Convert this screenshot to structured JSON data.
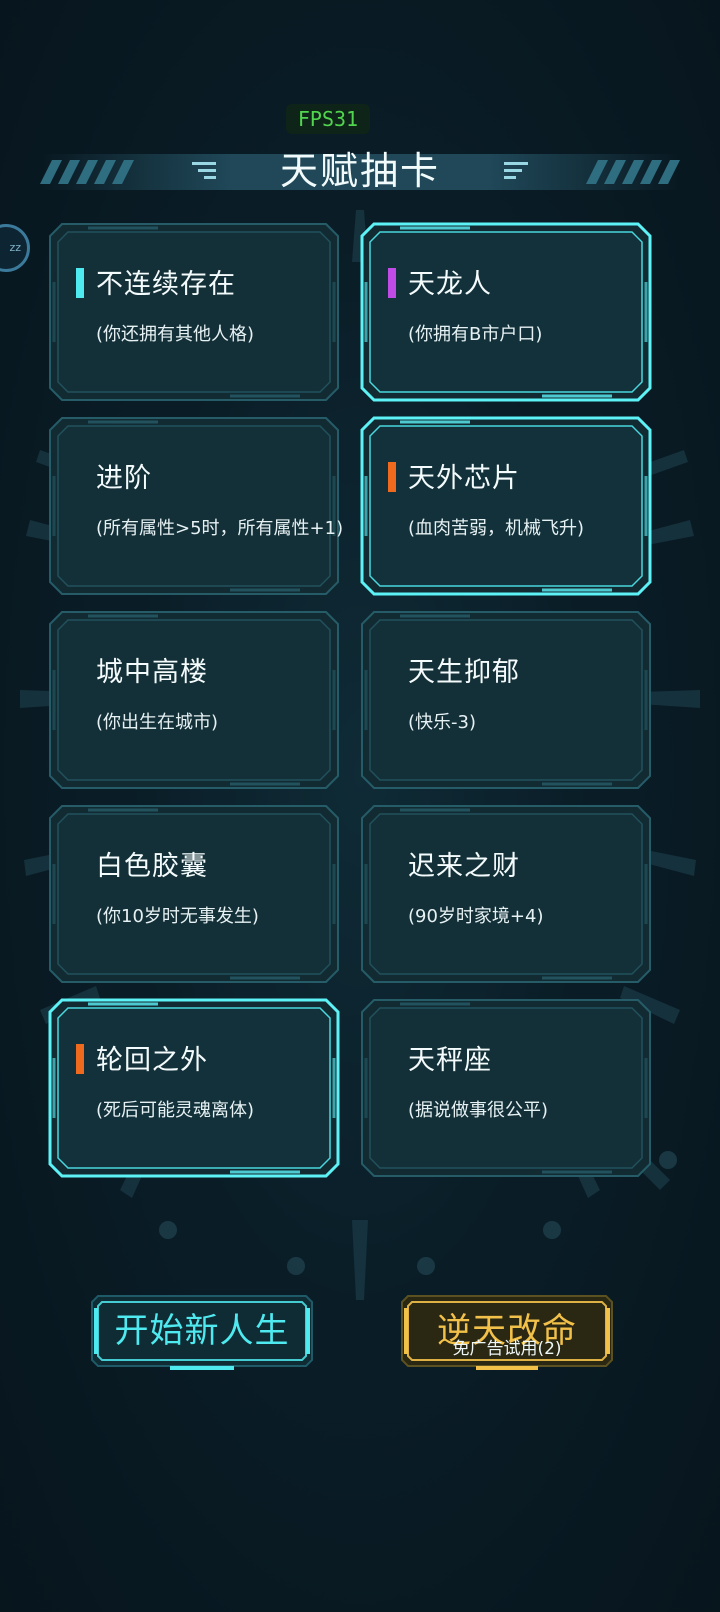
{
  "fps": "FPS31",
  "title": "天赋抽卡",
  "side_button_text": "zz",
  "cards": [
    {
      "title": "不连续存在",
      "desc": "(你还拥有其他人格)",
      "marker": "#4fe9f0",
      "highlighted": false
    },
    {
      "title": "天龙人",
      "desc": "(你拥有B市户口)",
      "marker": "#c04be6",
      "highlighted": true
    },
    {
      "title": "进阶",
      "desc": "(所有属性>5时，所有属性+1)",
      "marker": "",
      "highlighted": false
    },
    {
      "title": "天外芯片",
      "desc": "(血肉苦弱，机械飞升)",
      "marker": "#ef6a1d",
      "highlighted": true
    },
    {
      "title": "城中高楼",
      "desc": "(你出生在城市)",
      "marker": "",
      "highlighted": false
    },
    {
      "title": "天生抑郁",
      "desc": "(快乐-3)",
      "marker": "",
      "highlighted": false
    },
    {
      "title": "白色胶囊",
      "desc": "(你10岁时无事发生)",
      "marker": "",
      "highlighted": false
    },
    {
      "title": "迟来之财",
      "desc": "(90岁时家境+4)",
      "marker": "",
      "highlighted": false
    },
    {
      "title": "轮回之外",
      "desc": "(死后可能灵魂离体)",
      "marker": "#ef6a1d",
      "highlighted": true
    },
    {
      "title": "天秤座",
      "desc": "(据说做事很公平)",
      "marker": "",
      "highlighted": false
    }
  ],
  "buttons": {
    "start": "开始新人生",
    "defy": "逆天改命",
    "ad_note": "免广告试用(2)"
  },
  "colors": {
    "cyan": "#4fe9f0",
    "gold": "#f2c14a",
    "card_fill": "#132f38"
  }
}
